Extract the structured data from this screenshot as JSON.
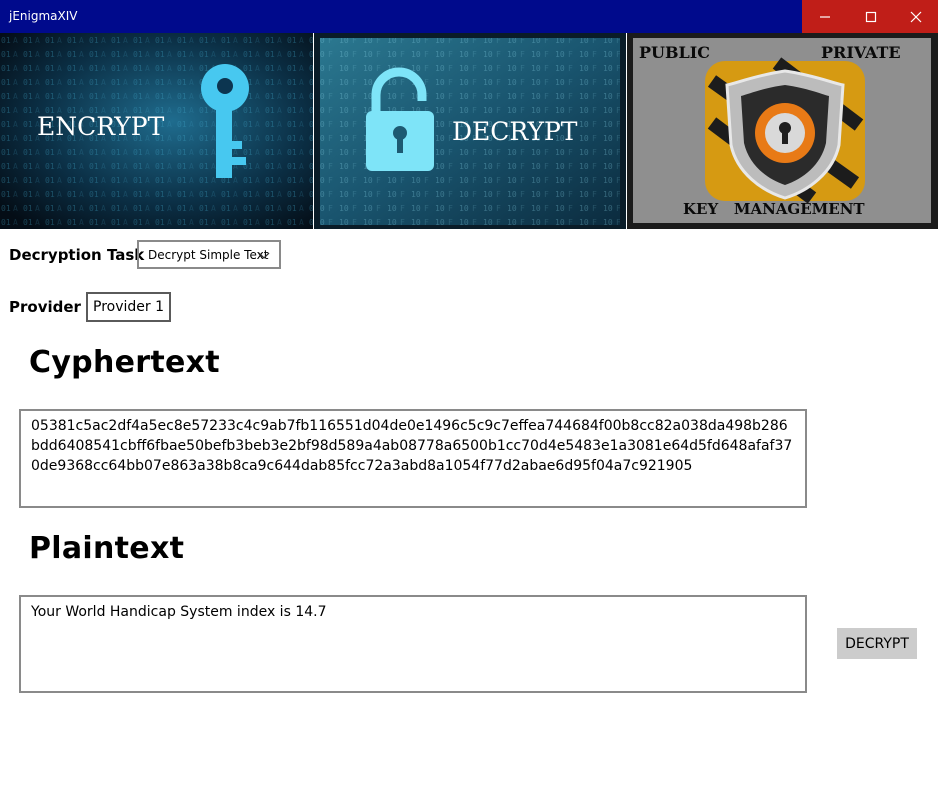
{
  "window": {
    "title": "jEnigmaXIV"
  },
  "banners": {
    "encrypt": {
      "text": "ENCRYPT"
    },
    "decrypt": {
      "text": "DECRYPT"
    },
    "keys": {
      "public": "PUBLIC",
      "private": "PRIVATE",
      "management": "KEY   MANAGEMENT"
    }
  },
  "task": {
    "label": "Decryption Task",
    "selected": "Decrypt Simple Text"
  },
  "provider": {
    "label": "Provider",
    "value": "Provider 1"
  },
  "cyphertext": {
    "heading": "Cyphertext",
    "value": "05381c5ac2df4a5ec8e57233c4c9ab7fb116551d04de0e1496c5c9c7effea744684f00b8cc82a038da498b286bdd6408541cbff6fbae50befb3beb3e2bf98d589a4ab08778a6500b1cc70d4e5483e1a3081e64d5fd648afaf370de9368cc64bb07e863a38b8ca9c644dab85fcc72a3abd8a1054f77d2abae6d95f04a7c921905"
  },
  "plaintext": {
    "heading": "Plaintext",
    "value": "Your World Handicap System index is 14.7"
  },
  "actions": {
    "decrypt": "DECRYPT"
  }
}
